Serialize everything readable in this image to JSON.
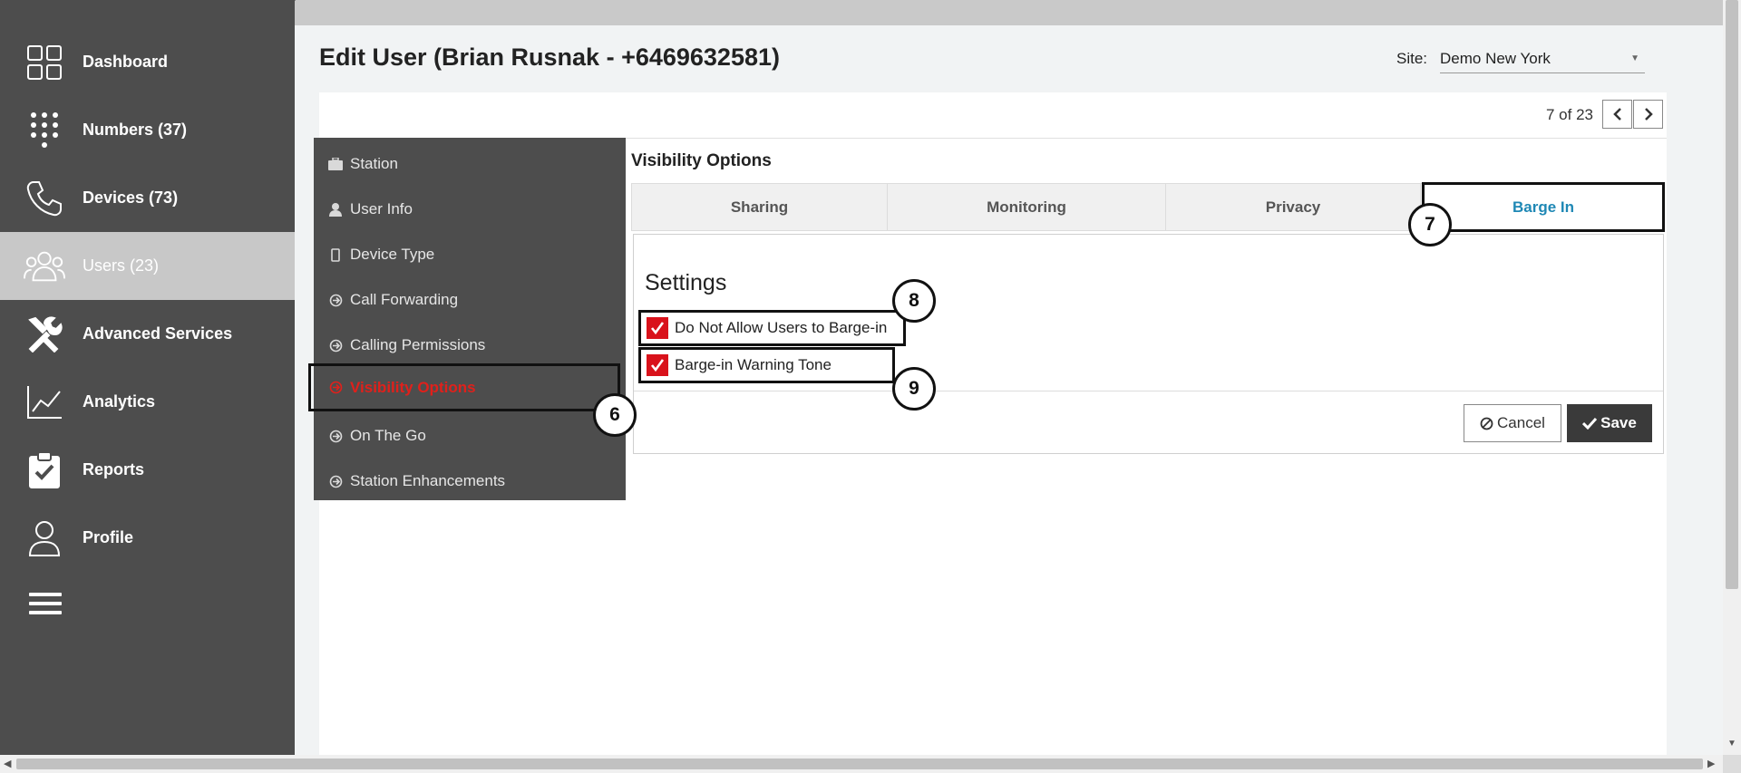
{
  "nav": {
    "items": [
      {
        "label": "Dashboard",
        "icon": "dashboard-grid-icon"
      },
      {
        "label": "Numbers (37)",
        "icon": "dialpad-icon"
      },
      {
        "label": "Devices (73)",
        "icon": "phone-icon"
      },
      {
        "label": "Users (23)",
        "icon": "users-icon",
        "active": true
      },
      {
        "label": "Advanced Services",
        "icon": "tools-icon"
      },
      {
        "label": "Analytics",
        "icon": "analytics-chart-icon"
      },
      {
        "label": "Reports",
        "icon": "clipboard-check-icon"
      },
      {
        "label": "Profile",
        "icon": "profile-icon"
      }
    ],
    "menu_icon": "hamburger-menu-icon"
  },
  "header": {
    "title": "Edit User (Brian Rusnak - +6469632581)",
    "site_label": "Site:",
    "site_value": "Demo New York"
  },
  "pager": {
    "text": "7 of 23",
    "prev_icon": "chevron-left-icon",
    "next_icon": "chevron-right-icon"
  },
  "submenu": {
    "items": [
      {
        "label": "Station",
        "icon": "briefcase-icon"
      },
      {
        "label": "User Info",
        "icon": "user-icon"
      },
      {
        "label": "Device Type",
        "icon": "mobile-icon"
      },
      {
        "label": "Call Forwarding",
        "icon": "circle-arrow-icon"
      },
      {
        "label": "Calling Permissions",
        "icon": "circle-arrow-icon"
      },
      {
        "label": "Visibility Options",
        "icon": "circle-arrow-icon",
        "active": true
      },
      {
        "label": "On The Go",
        "icon": "circle-arrow-icon"
      },
      {
        "label": "Station Enhancements",
        "icon": "circle-arrow-icon"
      }
    ]
  },
  "content": {
    "section_title": "Visibility Options",
    "tabs": [
      {
        "label": "Sharing"
      },
      {
        "label": "Monitoring"
      },
      {
        "label": "Privacy"
      },
      {
        "label": "Barge In",
        "active": true
      }
    ],
    "settings_title": "Settings",
    "checkboxes": [
      {
        "label": "Do Not Allow Users to Barge-in",
        "checked": true
      },
      {
        "label": "Barge-in Warning Tone",
        "checked": true
      }
    ],
    "cancel_label": "Cancel",
    "save_label": "Save"
  },
  "callouts": [
    "6",
    "7",
    "8",
    "9"
  ],
  "colors": {
    "nav_bg": "#4d4d4d",
    "nav_active_bg": "#c8c8c8",
    "active_submenu_text": "#e0201b",
    "active_tab_text": "#1f88b5",
    "checkbox": "#d9121b",
    "save_button": "#3a3a3a"
  }
}
